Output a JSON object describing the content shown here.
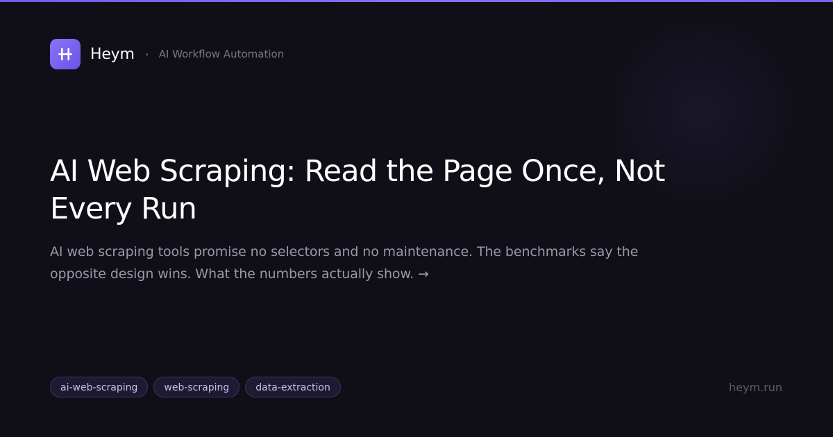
{
  "brand": {
    "name": "Heym",
    "tagline": "AI Workflow Automation",
    "logo_icon": "two-bars-icon",
    "accent_color": "#7b64f3"
  },
  "article": {
    "title": "AI Web Scraping: Read the Page Once, Not Every Run",
    "subtitle": "AI web scraping tools promise no selectors and no maintenance. The benchmarks say the opposite design wins. What the numbers actually show. →"
  },
  "tags": [
    "ai-web-scraping",
    "web-scraping",
    "data-extraction"
  ],
  "site": "heym.run",
  "colors": {
    "background": "#100f17",
    "top_accent": "#7b64f3",
    "tag_background": "#1e1a33",
    "tag_border": "#3a3263"
  }
}
